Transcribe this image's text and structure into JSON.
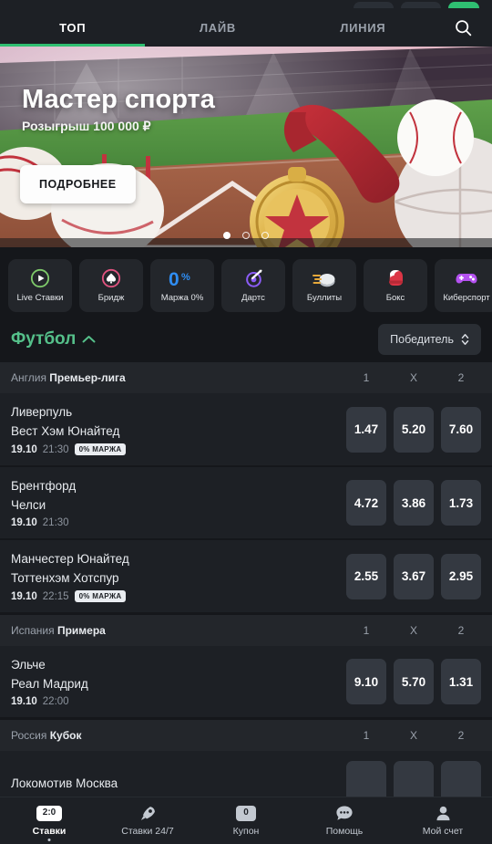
{
  "theme": {
    "bg": "#15171b",
    "surface": "#1d2025",
    "surface_alt": "#23262b",
    "odd_bg": "#343941",
    "accent_green": "#2fbf71",
    "sport_green": "#55c08a",
    "text_primary": "#e8ebef",
    "text_muted": "#9aa1ab"
  },
  "tabs": [
    {
      "label": "ТОП",
      "active": true,
      "name": "tab-top"
    },
    {
      "label": "ЛАЙВ",
      "active": false,
      "name": "tab-live"
    },
    {
      "label": "ЛИНИЯ",
      "active": false,
      "name": "tab-line"
    }
  ],
  "search": {
    "icon": "search-icon"
  },
  "banner": {
    "title": "Мастер спорта",
    "subtitle": "Розыгрыш 100 000 ₽",
    "button": "ПОДРОБНЕЕ",
    "dots": 3,
    "active_dot": 0
  },
  "categories": [
    {
      "label": "Live Ставки",
      "icon": "play-circle-icon",
      "color": "#7ec96a"
    },
    {
      "label": "Бридж",
      "icon": "spade-circle-icon",
      "color": "#e0537f"
    },
    {
      "label": "Маржа 0%",
      "icon": "zero-percent-icon",
      "color": "#2f8ef4"
    },
    {
      "label": "Дартс",
      "icon": "dartboard-icon",
      "color": "#8b5cf6"
    },
    {
      "label": "Буллиты",
      "icon": "puck-icon",
      "color": "#e0e3e8"
    },
    {
      "label": "Бокс",
      "icon": "boxing-glove-icon",
      "color": "#e0384a"
    },
    {
      "label": "Киберспорт",
      "icon": "gamepad-icon",
      "color": "#b451f0"
    }
  ],
  "sport_section": {
    "name": "Футбол",
    "collapse_icon": "chevron-up-icon",
    "selector_value": "Победитель",
    "selector_icon": "chevron-updown-icon"
  },
  "odds_columns": [
    "1",
    "X",
    "2"
  ],
  "leagues": [
    {
      "country": "Англия",
      "name": "Премьер-лига",
      "matches": [
        {
          "home": "Ливерпуль",
          "away": "Вест Хэм Юнайтед",
          "date": "19.10",
          "time": "21:30",
          "badge": "0% МАРЖА",
          "odds": [
            "1.47",
            "5.20",
            "7.60"
          ]
        },
        {
          "home": "Брентфорд",
          "away": "Челси",
          "date": "19.10",
          "time": "21:30",
          "badge": "",
          "odds": [
            "4.72",
            "3.86",
            "1.73"
          ]
        },
        {
          "home": "Манчестер Юнайтед",
          "away": "Тоттенхэм Хотспур",
          "date": "19.10",
          "time": "22:15",
          "badge": "0% МАРЖА",
          "odds": [
            "2.55",
            "3.67",
            "2.95"
          ]
        }
      ]
    },
    {
      "country": "Испания",
      "name": "Примера",
      "matches": [
        {
          "home": "Эльче",
          "away": "Реал Мадрид",
          "date": "19.10",
          "time": "22:00",
          "badge": "",
          "odds": [
            "9.10",
            "5.70",
            "1.31"
          ]
        }
      ]
    },
    {
      "country": "Россия",
      "name": "Кубок",
      "matches": [
        {
          "home": "Локомотив Москва",
          "away": "",
          "date": "",
          "time": "",
          "badge": "",
          "odds": [
            "",
            "",
            ""
          ]
        }
      ]
    }
  ],
  "bottom_nav": [
    {
      "label": "Ставки",
      "badge": "2:0",
      "badge_style": "white",
      "icon": "",
      "active": true
    },
    {
      "label": "Ставки 24/7",
      "badge": "",
      "badge_style": "",
      "icon": "rocket-icon",
      "active": false
    },
    {
      "label": "Купон",
      "badge": "0",
      "badge_style": "grey",
      "icon": "",
      "active": false
    },
    {
      "label": "Помощь",
      "badge": "",
      "badge_style": "",
      "icon": "chat-dots-icon",
      "active": false
    },
    {
      "label": "Мой счет",
      "badge": "",
      "badge_style": "",
      "icon": "person-icon",
      "active": false
    }
  ]
}
